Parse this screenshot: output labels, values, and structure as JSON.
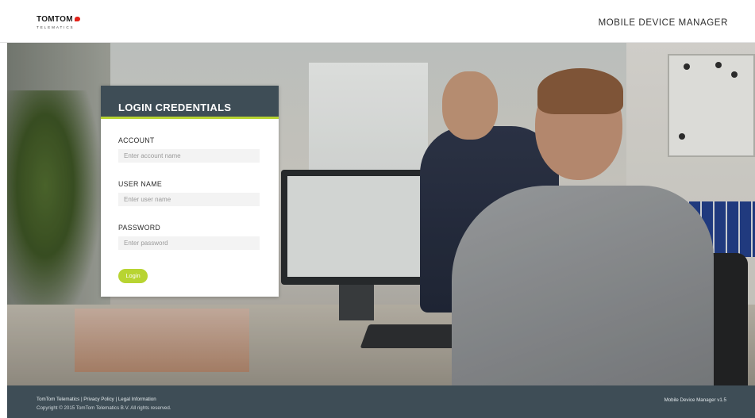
{
  "header": {
    "logo_main": "TOMTOM",
    "logo_sub": "TELEMATICS",
    "app_title": "MOBILE DEVICE MANAGER"
  },
  "login": {
    "title": "LOGIN CREDENTIALS",
    "account_label": "ACCOUNT",
    "account_placeholder": "Enter account name",
    "account_value": "",
    "username_label": "USER NAME",
    "username_placeholder": "Enter user name",
    "username_value": "",
    "password_label": "PASSWORD",
    "password_placeholder": "Enter password",
    "password_value": "",
    "button_label": "Login"
  },
  "footer": {
    "link_company": "TomTom Telematics",
    "link_privacy": "Privacy Policy",
    "link_legal": "Legal Information",
    "separator": " | ",
    "copyright": "Copyright © 2015 TomTom Telematics B.V. All rights reserved.",
    "version": "Mobile Device Manager v1.5"
  },
  "colors": {
    "header_bg": "#ffffff",
    "panel_head": "#3e4d56",
    "accent": "#b8d432",
    "logo_red": "#e2231a",
    "footer_bg": "#3e4d56"
  },
  "icons": {
    "logo": "tomtom-logo-icon"
  }
}
